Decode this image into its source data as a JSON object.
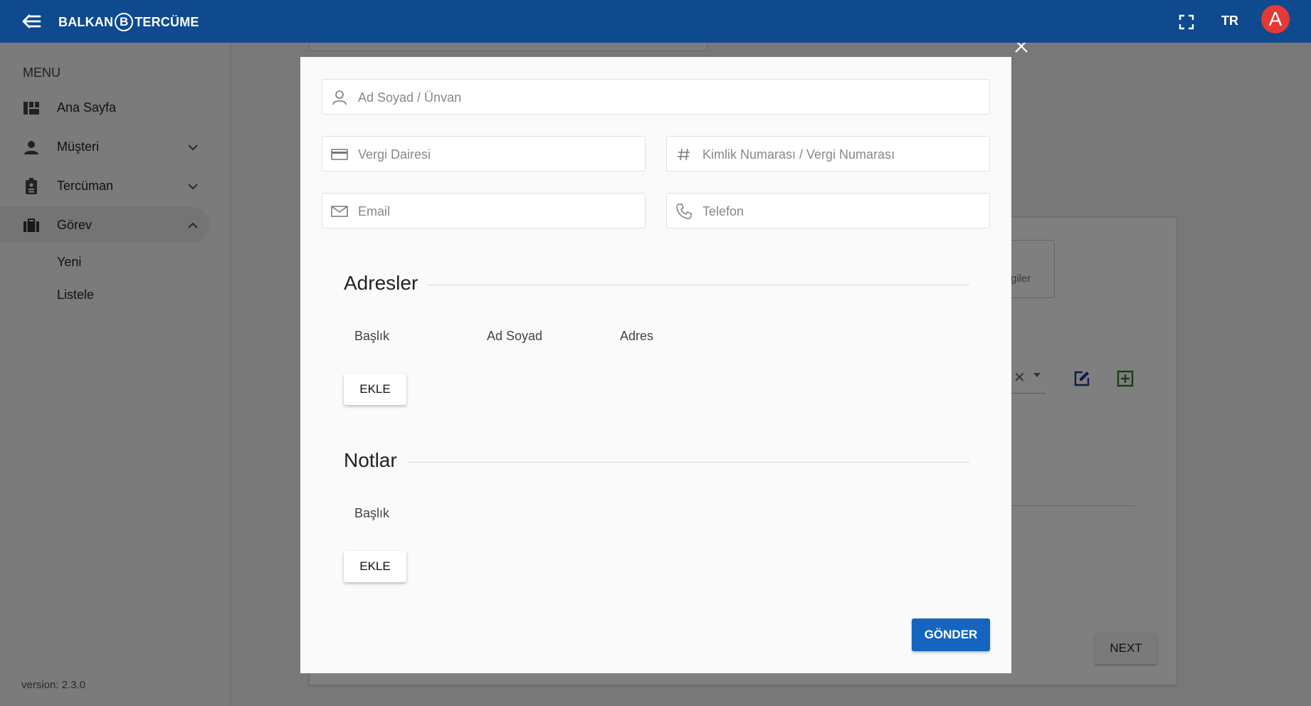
{
  "topbar": {
    "logo_left": "BALKAN",
    "logo_mark": "B",
    "logo_right": "TERCÜME",
    "language": "TR",
    "avatar_letter": "A",
    "color": "#0f4a8f"
  },
  "sidebar": {
    "menu_title": "MENU",
    "items": [
      {
        "label": "Ana Sayfa",
        "icon": "dashboard-icon"
      },
      {
        "label": "Müşteri",
        "icon": "person-icon"
      },
      {
        "label": "Tercüman",
        "icon": "badge-icon"
      },
      {
        "label": "Görev",
        "icon": "briefcase-icon",
        "active": true
      }
    ],
    "sub_items": [
      "Yeni",
      "Listele"
    ],
    "version": "version: 2.3.0"
  },
  "background": {
    "box_text": "giler",
    "next_label": "NEXT"
  },
  "modal": {
    "fields": {
      "name_placeholder": "Ad Soyad / Ünvan",
      "tax_office_placeholder": "Vergi Dairesi",
      "id_number_placeholder": "Kimlik Numarası / Vergi Numarası",
      "email_placeholder": "Email",
      "phone_placeholder": "Telefon"
    },
    "addresses": {
      "title": "Adresler",
      "columns": [
        "Başlık",
        "Ad Soyad",
        "Adres"
      ],
      "add_label": "EKLE"
    },
    "notes": {
      "title": "Notlar",
      "columns": [
        "Başlık"
      ],
      "add_label": "EKLE"
    },
    "submit_label": "GÖNDER",
    "accent_color": "#1565c0"
  }
}
